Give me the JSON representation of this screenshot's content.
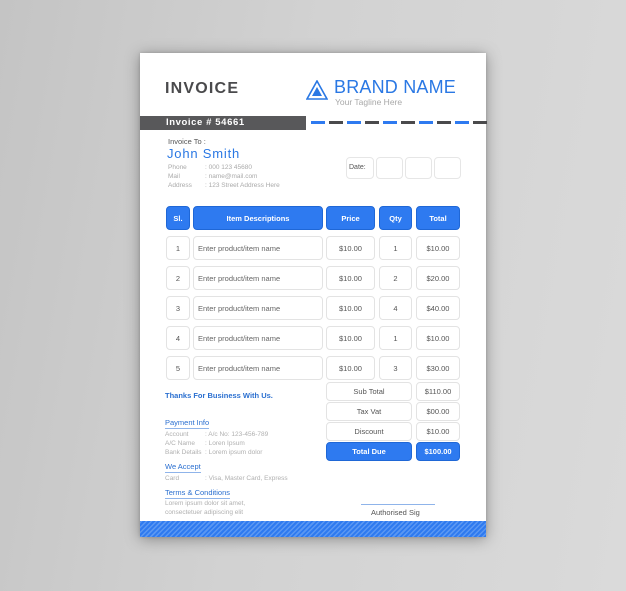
{
  "header": {
    "title": "INVOICE",
    "brand_name": "BRAND NAME",
    "tagline": "Your Tagline Here",
    "invoice_number_label": "Invoice # 54661",
    "dash_colors": [
      "#2e7af0",
      "#4a4a4c"
    ]
  },
  "bill_to": {
    "label": "Invoice To :",
    "name": "John Smith",
    "contact": [
      {
        "key": "Phone",
        "value": ": 000 123 45680"
      },
      {
        "key": "Mail",
        "value": ": name@mail.com"
      },
      {
        "key": "Address",
        "value": ": 123 Street Address Here"
      }
    ]
  },
  "date": {
    "label": "Date:",
    "day": "",
    "month": "",
    "year": ""
  },
  "table": {
    "headers": [
      "Sl.",
      "Item Descriptions",
      "Price",
      "Qty",
      "Total"
    ],
    "rows": [
      {
        "sl": "1",
        "desc": "Enter product/item name",
        "price": "$10.00",
        "qty": "1",
        "total": "$10.00"
      },
      {
        "sl": "2",
        "desc": "Enter product/item name",
        "price": "$10.00",
        "qty": "2",
        "total": "$20.00"
      },
      {
        "sl": "3",
        "desc": "Enter product/item name",
        "price": "$10.00",
        "qty": "4",
        "total": "$40.00"
      },
      {
        "sl": "4",
        "desc": "Enter product/item name",
        "price": "$10.00",
        "qty": "1",
        "total": "$10.00"
      },
      {
        "sl": "5",
        "desc": "Enter product/item name",
        "price": "$10.00",
        "qty": "3",
        "total": "$30.00"
      }
    ]
  },
  "summary": {
    "sub_total_label": "Sub Total",
    "sub_total": "$110.00",
    "tax_label": "Tax Vat",
    "tax": "$00.00",
    "discount_label": "Discount",
    "discount": "$10.00",
    "total_due_label": "Total Due",
    "total_due": "$100.00"
  },
  "footer": {
    "thanks": "Thanks For Business With Us.",
    "payment_title": "Payment Info",
    "payment": [
      {
        "key": "Account",
        "value": ": A/c No: 123-456-789"
      },
      {
        "key": "A/C Name",
        "value": ": Loren Ipsum"
      },
      {
        "key": "Bank Details",
        "value": ": Lorem ipsum dolor"
      }
    ],
    "accept_title": "We Accept",
    "accept": {
      "key": "Card",
      "value": ": Visa, Master Card, Express"
    },
    "terms_title": "Terms & Conditions",
    "terms_lines": [
      "Lorem ipsum dolor sit amet,",
      "consectetuer adipiscing elit"
    ],
    "signature_label": "Authorised Sig"
  },
  "colors": {
    "accent": "#2e7af0",
    "dark": "#4a4a4c"
  }
}
